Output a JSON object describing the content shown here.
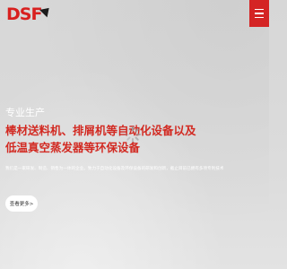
{
  "brand": {
    "logo_text": "DSF",
    "accent_color": "#d42424",
    "mark_icon": "arrow-mark-icon"
  },
  "header": {
    "menu_icon": "hamburger-menu-icon"
  },
  "hero": {
    "subtitle": "专业生产",
    "headline_line1": "棒材送料机、排屑机等自动化设备以及",
    "headline_line2": "低温真空蒸发器等环保设备",
    "description": "我们是一家研发、制造、销售为一体的企业。致力于自动化设备及环保设备的研发和创新，截止目前已拥有多项专利技术",
    "more_button_label": "查看更多>",
    "headline_color": "#d22a22",
    "loading_icon": "loading-spinner-icon"
  }
}
